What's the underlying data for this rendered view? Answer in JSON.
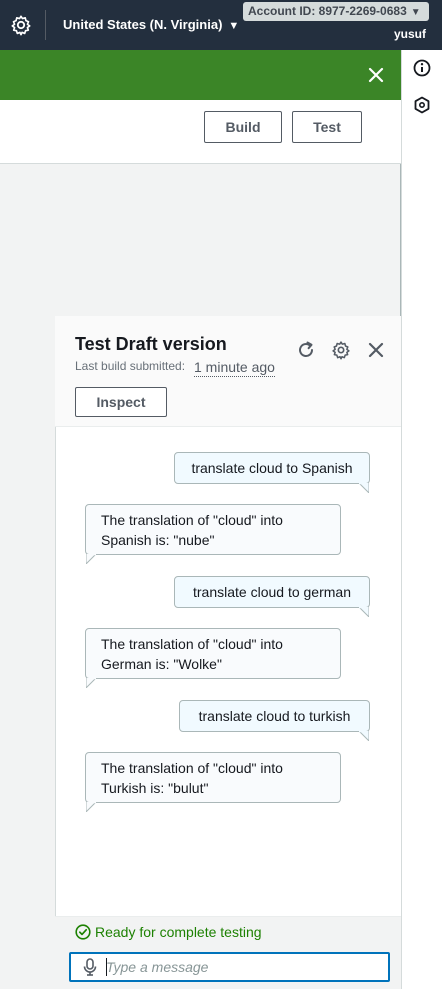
{
  "topbar": {
    "region": "United States (N. Virginia)",
    "account_id": "Account ID: 8977-2269-0683",
    "user": "yusuf"
  },
  "header": {
    "build_label": "Build",
    "test_label": "Test"
  },
  "test_panel": {
    "title": "Test Draft version",
    "last_build_label": "Last build submitted:",
    "last_build_time": "1 minute ago",
    "inspect_label": "Inspect",
    "messages": [
      {
        "from": "user",
        "text": "translate cloud to Spanish"
      },
      {
        "from": "bot",
        "line1": "The translation of \"cloud\" into",
        "line2": "Spanish is: \"nube\""
      },
      {
        "from": "user",
        "text": "translate cloud to german"
      },
      {
        "from": "bot",
        "line1": "The translation of \"cloud\" into",
        "line2": "German is: \"Wolke\""
      },
      {
        "from": "user",
        "text": "translate cloud to turkish"
      },
      {
        "from": "bot",
        "line1": "The translation of \"cloud\" into",
        "line2": "Turkish is: \"bulut\""
      }
    ],
    "status_text": "Ready for complete testing",
    "input_placeholder": "Type a message",
    "input_value": ""
  },
  "colors": {
    "topbar_bg": "#232f3e",
    "flash_bg": "#3b8527",
    "success_text": "#1d8102",
    "focus_border": "#0073bb"
  },
  "icons": [
    "settings-gear-icon",
    "caret-down-icon",
    "close-icon",
    "info-icon",
    "hexagon-icon",
    "refresh-icon",
    "gear-icon",
    "check-circle-icon",
    "microphone-icon"
  ]
}
